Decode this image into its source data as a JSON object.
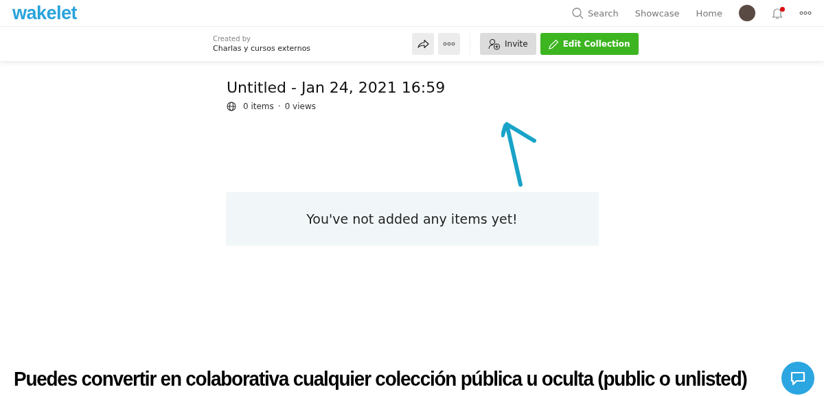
{
  "logo": "wakelet",
  "nav": {
    "search": "Search",
    "links": [
      "Showcase",
      "Home"
    ],
    "notifications_unread": true
  },
  "toolbar": {
    "created_by_label": "Created by",
    "creator": "Charlas y cursos externos",
    "invite": "Invite",
    "edit": "Edit Collection"
  },
  "collection": {
    "title": "Untitled - Jan 24, 2021 16:59",
    "items": "0 items",
    "separator": "·",
    "views": "0 views"
  },
  "empty_message": "You've not added any items yet!",
  "caption": "Puedes convertir en colaborativa cualquier colección pública u oculta (public o unlisted)"
}
